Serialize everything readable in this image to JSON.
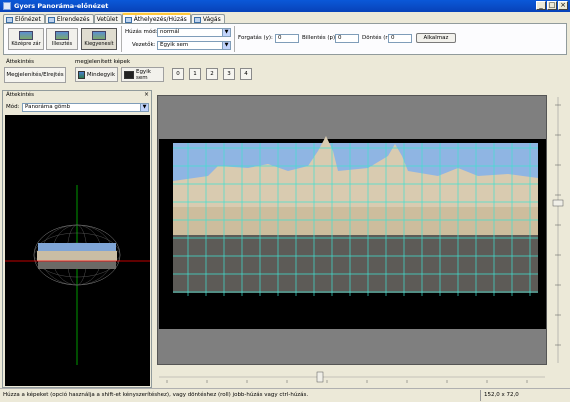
{
  "window": {
    "title": "Gyors Panoráma-előnézet",
    "controls": [
      "_",
      "□",
      "×"
    ]
  },
  "tabs": [
    {
      "label": "Előnézet",
      "icon": "preview-icon",
      "active": false
    },
    {
      "label": "Elrendezés",
      "icon": "layout-icon",
      "active": false
    },
    {
      "label": "Vetület",
      "icon": "projection-icon",
      "active": false
    },
    {
      "label": "Áthelyezés/Húzás",
      "icon": "drag-icon",
      "active": true
    },
    {
      "label": "Vágás",
      "icon": "crop-icon",
      "active": false
    }
  ],
  "toolbar": {
    "center_label": "Középre zár",
    "fit_label": "Illesztés",
    "straighten_label": "Kiegyenesít",
    "drag_mode_label": "Húzás mód:",
    "drag_mode_value": "normál",
    "guide_label": "Vezetők:",
    "guide_value": "Egyik sem",
    "yaw_label": "Forgatás (y):",
    "yaw_value": "0",
    "pitch_label": "Billentés (p):",
    "pitch_value": "0",
    "roll_label": "Döntés (r):",
    "roll_value": "0",
    "apply_label": "Alkalmaz"
  },
  "overview_group": {
    "title": "Áttekintés",
    "button": "Megjelenítés/Elrejtés"
  },
  "displayed_images": {
    "title": "megjelenített képek",
    "all_label": "Mindegyik",
    "none_label": "Egyik sem",
    "numbers": [
      "0",
      "1",
      "2",
      "3",
      "4"
    ]
  },
  "overview_panel": {
    "title": "Áttekintés",
    "close": "×",
    "mode_label": "Mód:",
    "mode_value": "Panoráma gömb"
  },
  "status": {
    "hint": "Húzza a képeket (opció használja a shift-et kényszerítéshez), vagy döntéshez (roll) jobb-húzás vagy ctrl-húzás.",
    "coords": "152,0 x 72,0"
  },
  "colors": {
    "titlebar": "#0a58d8",
    "grid_line": "#40e0d0",
    "horizon_line": "#ff0000",
    "vertical_line": "#00c000",
    "tab_highlight": "#ffc83c"
  }
}
